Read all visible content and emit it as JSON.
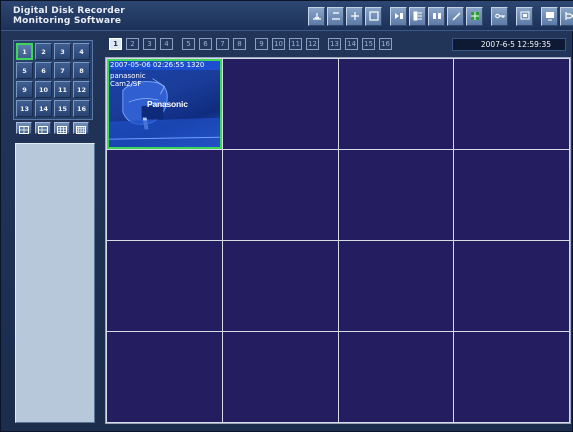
{
  "app": {
    "title": "Digital Disk Recorder\nMonitoring Software"
  },
  "toolbar": {
    "icons": [
      "play-back-icon",
      "stop-icon",
      "multi-screen-icon",
      "zoom-icon",
      "camera-control-icon",
      "record-list-icon",
      "edit-icon",
      "pen-icon",
      "grid-icon",
      "key-icon",
      "monitor-icon",
      "computer-icon",
      "exit-icon"
    ]
  },
  "camera_pad": {
    "buttons": [
      "1",
      "2",
      "3",
      "4",
      "5",
      "6",
      "7",
      "8",
      "9",
      "10",
      "11",
      "12",
      "13",
      "14",
      "15",
      "16"
    ],
    "active": "1"
  },
  "layout_buttons": [
    "single-layout-icon",
    "quad-layout-icon",
    "nine-layout-icon",
    "sixteen-layout-icon"
  ],
  "channels": {
    "labels": [
      "1",
      "2",
      "3",
      "4",
      "5",
      "6",
      "7",
      "8",
      "9",
      "10",
      "11",
      "12",
      "13",
      "14",
      "15",
      "16"
    ],
    "active": "1"
  },
  "datetime": "2007-6-5  12:59:35",
  "feed": {
    "timestamp": "2007-05-06 02:26:55 1320",
    "line1": "panasonic",
    "line2": "Cam2/SF",
    "brand": "Panasonic"
  },
  "colors": {
    "accent": "#3dd65a",
    "grid_cell": "#241d60",
    "feed_header": "#1b4fd0"
  }
}
